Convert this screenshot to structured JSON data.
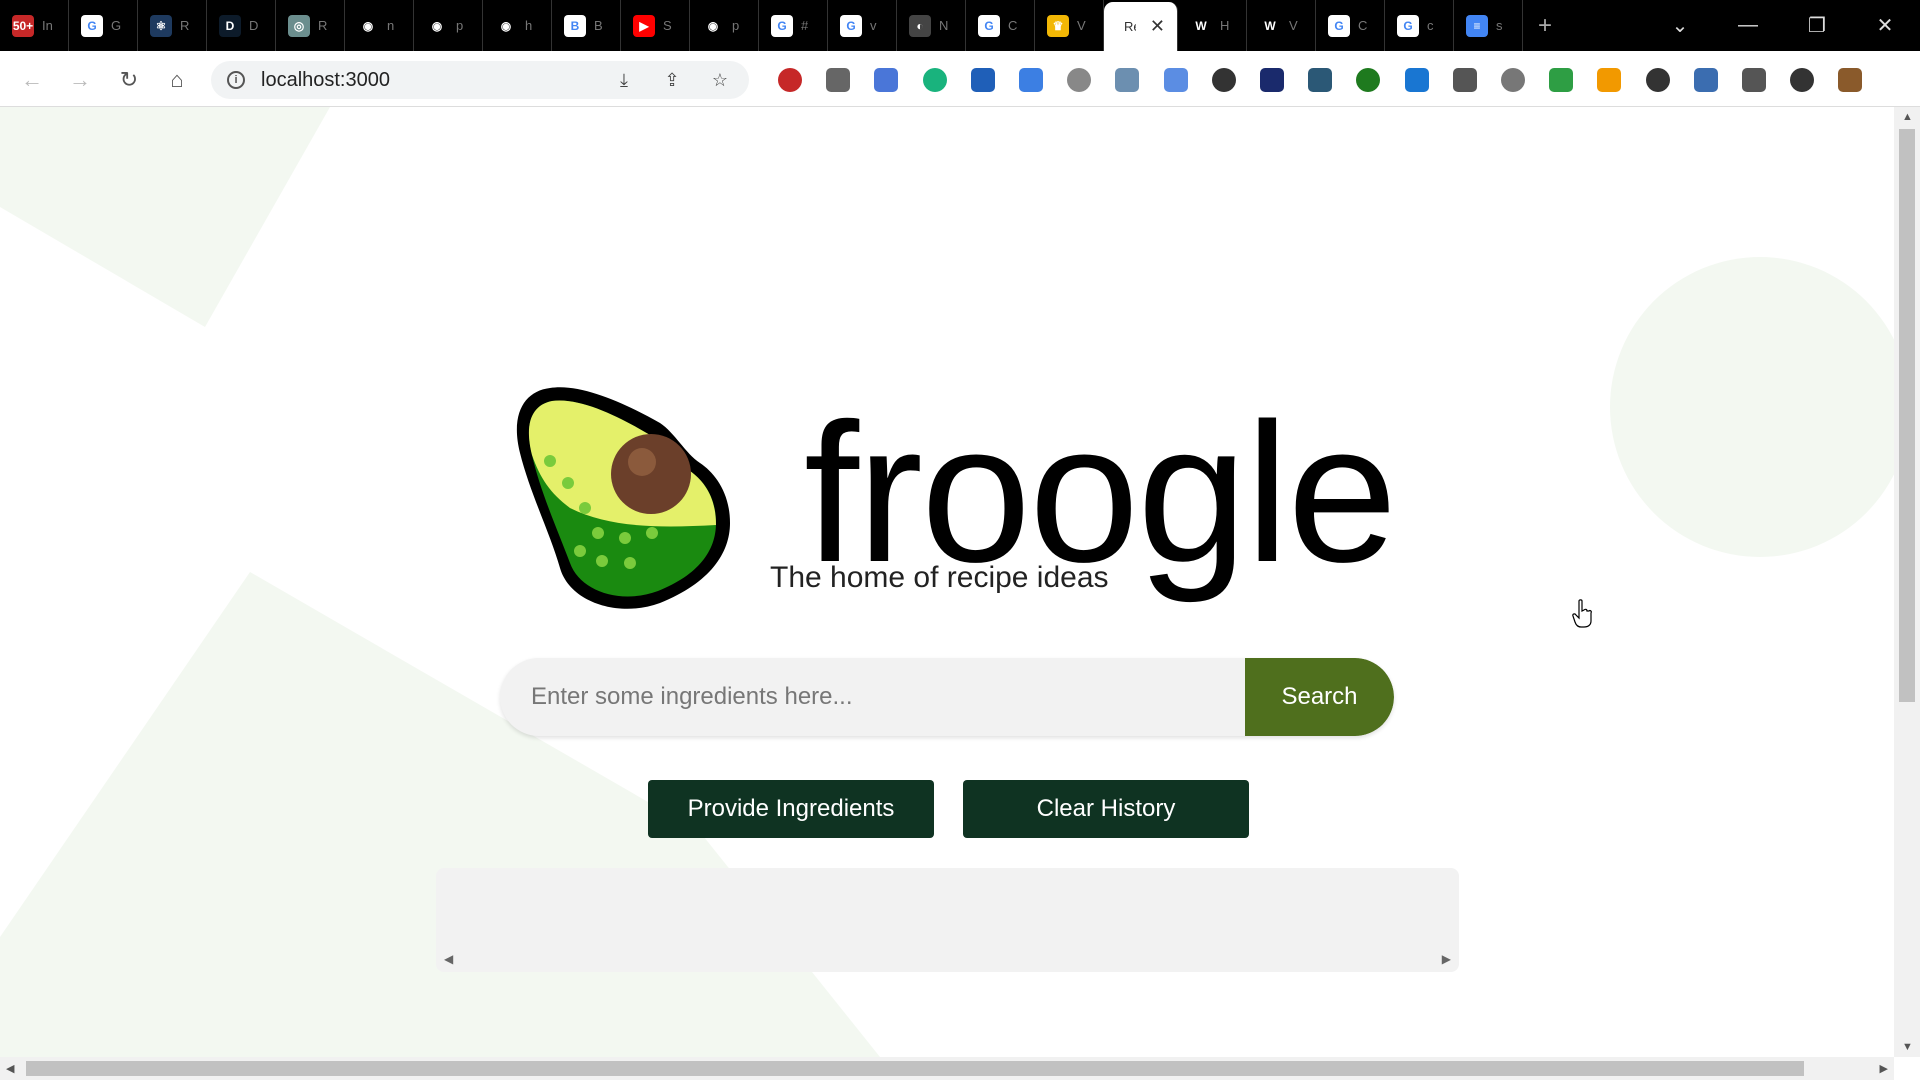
{
  "browser": {
    "tabs": [
      {
        "title": "In",
        "favicon_color": "#c62828",
        "favicon_text": "50+"
      },
      {
        "title": "G",
        "favicon_color": "#ffffff",
        "favicon_text": "G"
      },
      {
        "title": "R",
        "favicon_color": "#1e3a5f",
        "favicon_text": "⚛"
      },
      {
        "title": "D",
        "favicon_color": "#0d1b2a",
        "favicon_text": "D"
      },
      {
        "title": "R",
        "favicon_color": "#6b8e8e",
        "favicon_text": "◎"
      },
      {
        "title": "n",
        "favicon_color": "#000000",
        "favicon_text": "◉"
      },
      {
        "title": "p",
        "favicon_color": "#000000",
        "favicon_text": "◉"
      },
      {
        "title": "h",
        "favicon_color": "#000000",
        "favicon_text": "◉"
      },
      {
        "title": "B",
        "favicon_color": "#ffffff",
        "favicon_text": "B"
      },
      {
        "title": "S",
        "favicon_color": "#ff0000",
        "favicon_text": "▶"
      },
      {
        "title": "p",
        "favicon_color": "#000000",
        "favicon_text": "◉"
      },
      {
        "title": "#",
        "favicon_color": "#ffffff",
        "favicon_text": "G"
      },
      {
        "title": "v",
        "favicon_color": "#ffffff",
        "favicon_text": "G"
      },
      {
        "title": "N",
        "favicon_color": "#444444",
        "favicon_text": "◐"
      },
      {
        "title": "C",
        "favicon_color": "#ffffff",
        "favicon_text": "G"
      },
      {
        "title": "V",
        "favicon_color": "#f2b705",
        "favicon_text": "♛"
      },
      {
        "title": "Re",
        "favicon_color": "#ffffff",
        "favicon_text": ""
      },
      {
        "title": "H",
        "favicon_color": "#000000",
        "favicon_text": "W"
      },
      {
        "title": "V",
        "favicon_color": "#000000",
        "favicon_text": "W"
      },
      {
        "title": "C",
        "favicon_color": "#ffffff",
        "favicon_text": "G"
      },
      {
        "title": "c",
        "favicon_color": "#ffffff",
        "favicon_text": "G"
      },
      {
        "title": "s",
        "favicon_color": "#4285f4",
        "favicon_text": "≡"
      }
    ],
    "url": "localhost:3000",
    "extension_colors": [
      "#c62828",
      "#666666",
      "#4a76d8",
      "#19b37d",
      "#1f5fb8",
      "#3c7fe3",
      "#888888",
      "#6c8fb0",
      "#5b8de3",
      "#333333",
      "#1a2a6c",
      "#2b5876",
      "#1e7a1e",
      "#1976d2",
      "#555555",
      "#777777",
      "#2e9e44",
      "#f29900",
      "#333333",
      "#3b6db0",
      "#555555",
      "#333333",
      "#8a5a2b"
    ]
  },
  "app": {
    "name": "froogle",
    "tagline": "The home of recipe ideas",
    "search": {
      "placeholder": "Enter some ingredients here...",
      "value": "",
      "button_label": "Search"
    },
    "actions": {
      "provide_label": "Provide Ingredients",
      "clear_label": "Clear History"
    },
    "colors": {
      "search_button": "#4f6f1d",
      "action_button": "#0f3322",
      "decor": "#f3f8f1"
    }
  }
}
